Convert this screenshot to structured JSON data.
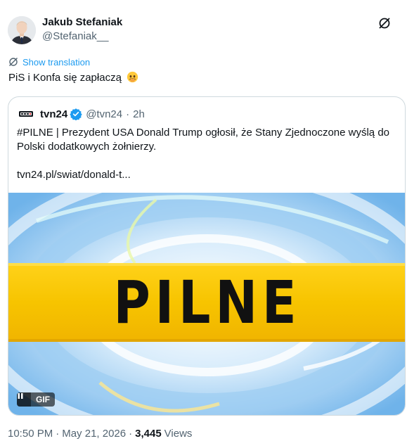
{
  "author": {
    "name": "Jakub Stefaniak",
    "handle": "@Stefaniak__"
  },
  "translation_label": "Show translation",
  "tweet_text": "PiS i Konfa się zapłaczą",
  "quote": {
    "name": "tvn24",
    "handle": "@tvn24",
    "separator": "·",
    "time": "2h",
    "lines": [
      "#PILNE | Prezydent USA Donald Trump ogłosił, że Stany Zjednoczone wyślą do",
      "Polski dodatkowych żołnierzy."
    ],
    "link": "tvn24.pl/swiat/donald-t...",
    "media_text": "PILNE",
    "gif_label": "GIF"
  },
  "meta": {
    "time": "10:50 PM",
    "dot": "·",
    "date": "May 21, 2026",
    "dot2": "·",
    "views_count": "3,445",
    "views_label": "Views"
  },
  "colors": {
    "accent": "#1d9bf0",
    "banner_yellow": "#f5c400",
    "text_primary": "#0f1419",
    "text_secondary": "#536471"
  }
}
